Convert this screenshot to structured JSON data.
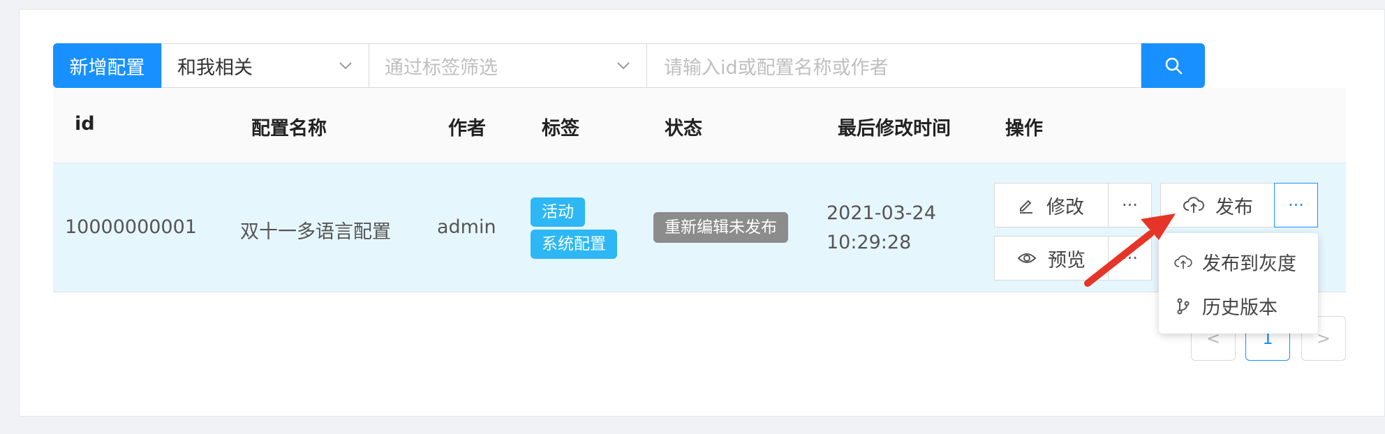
{
  "toolbar": {
    "add_button": "新增配置",
    "related_filter": "和我相关",
    "tag_filter_placeholder": "通过标签筛选",
    "search_placeholder": "请输入id或配置名称或作者"
  },
  "table": {
    "columns": [
      "id",
      "配置名称",
      "作者",
      "标签",
      "状态",
      "最后修改时间",
      "操作"
    ],
    "rows": [
      {
        "id": "10000000001",
        "name": "双十一多语言配置",
        "author": "admin",
        "tags": [
          "活动",
          "系统配置"
        ],
        "status": "重新编辑未发布",
        "modified_date": "2021-03-24",
        "modified_time": "10:29:28"
      }
    ],
    "actions": {
      "edit": "修改",
      "publish": "发布",
      "preview": "预览",
      "more": "···"
    }
  },
  "dropdown": {
    "items": [
      "发布到灰度",
      "历史版本"
    ]
  },
  "pagination": {
    "prev": "<",
    "current": "1",
    "next": ">"
  },
  "colors": {
    "primary": "#1890ff",
    "tag": "#2db7f5",
    "status_gray": "#8c8c8c",
    "row_highlight": "#e6f6fd",
    "annotation_arrow": "#e53528"
  }
}
